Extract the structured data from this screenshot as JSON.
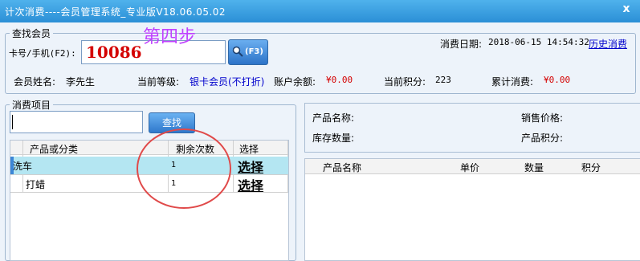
{
  "window": {
    "title": "计次消费----会员管理系统_专业版V18.06.05.02",
    "close_label": "x"
  },
  "find_member": {
    "legend": "查找会员",
    "card_label": "卡号/手机(F2):",
    "card_value": "10086",
    "step_note": "第四步",
    "f3_label": "(F3)",
    "date_label": "消费日期:",
    "date_value": "2018-06-15 14:54:32",
    "history_link": "历史消费",
    "name_label": "会员姓名:",
    "name_value": "李先生",
    "level_label": "当前等级:",
    "level_value": "银卡会员(不打折)",
    "balance_label": "账户余额:",
    "balance_value": "¥0.00",
    "points_label": "当前积分:",
    "points_value": "223",
    "total_label": "累计消费:",
    "total_value": "¥0.00"
  },
  "items": {
    "legend": "消费项目",
    "search_value": "",
    "search_button": "查找",
    "headers": [
      "产品或分类",
      "剩余次数",
      "选择"
    ],
    "rows": [
      {
        "name": "洗车",
        "remaining": "1",
        "action": "选择"
      },
      {
        "name": "打蜡",
        "remaining": "1",
        "action": "选择"
      }
    ]
  },
  "product_info": {
    "name_label": "产品名称:",
    "price_label": "销售价格:",
    "stock_label": "库存数量:",
    "points_label": "产品积分:"
  },
  "cart": {
    "headers": [
      "产品名称",
      "单价",
      "数量",
      "积分"
    ]
  },
  "colors": {
    "accent": "#2b8fd6",
    "amount_red": "#d40000",
    "level_blue": "#0000cc",
    "annotation": "#e04a4a"
  }
}
